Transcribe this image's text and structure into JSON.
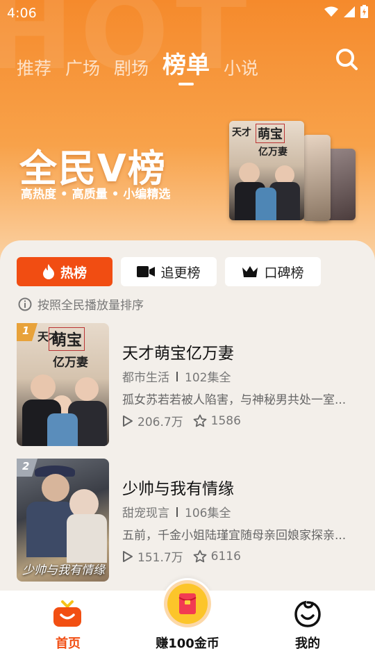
{
  "status": {
    "time": "4:06"
  },
  "tabs": [
    {
      "label": "推荐"
    },
    {
      "label": "广场"
    },
    {
      "label": "剧场"
    },
    {
      "label": "榜单"
    },
    {
      "label": "小说"
    }
  ],
  "active_tab": "榜单",
  "hero": {
    "bg_text": "HOT",
    "title": "全民V榜",
    "subtitle": "高热度 • 高质量 • 小编精选",
    "poster_text": [
      "天才",
      "萌宝",
      "亿万妻"
    ]
  },
  "filters": [
    {
      "label": "热榜",
      "icon": "flame-icon",
      "active": true
    },
    {
      "label": "追更榜",
      "icon": "video-camera-icon",
      "active": false
    },
    {
      "label": "口碑榜",
      "icon": "crown-icon",
      "active": false
    }
  ],
  "hint": "按照全民播放量排序",
  "ranking": [
    {
      "rank": "1",
      "title": "天才萌宝亿万妻",
      "genre": "都市生活",
      "episodes": "102集全",
      "desc": "孤女苏若若被人陷害，与神秘男共处一室...",
      "plays": "206.7万",
      "favorites": "1586",
      "cover_text": [
        "天才",
        "萌宝",
        "亿万妻"
      ]
    },
    {
      "rank": "2",
      "title": "少帅与我有情缘",
      "genre": "甜宠现言",
      "episodes": "106集全",
      "desc": "五前，千金小姐陆瑾宜随母亲回娘家探亲...",
      "plays": "151.7万",
      "favorites": "6116",
      "cover_text": "少帅与我有情缘"
    }
  ],
  "bottom_nav": [
    {
      "label": "首页",
      "icon": "tv-home-icon",
      "active": true
    },
    {
      "label": "赚100金币",
      "icon": "red-envelope-icon",
      "active": false
    },
    {
      "label": "我的",
      "icon": "smiley-profile-icon",
      "active": false
    }
  ],
  "colors": {
    "accent": "#f14d12",
    "hero_orange": "#f58a2c",
    "panel_bg": "#f3efea"
  }
}
